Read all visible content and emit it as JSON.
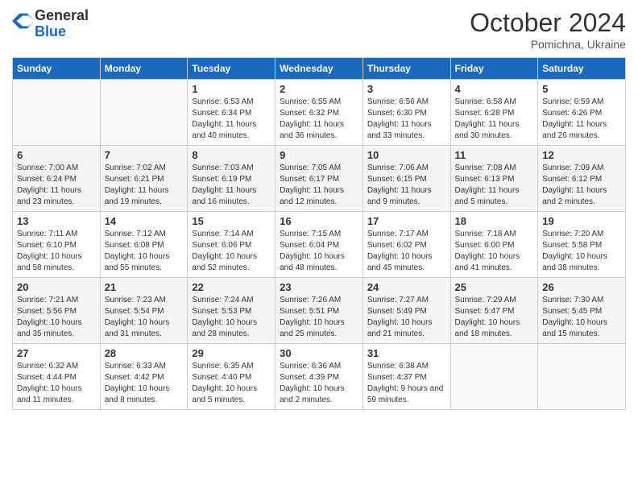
{
  "header": {
    "logo_general": "General",
    "logo_blue": "Blue",
    "month_title": "October 2024",
    "subtitle": "Pomichna, Ukraine"
  },
  "days_of_week": [
    "Sunday",
    "Monday",
    "Tuesday",
    "Wednesday",
    "Thursday",
    "Friday",
    "Saturday"
  ],
  "weeks": [
    [
      {
        "day": "",
        "info": ""
      },
      {
        "day": "",
        "info": ""
      },
      {
        "day": "1",
        "info": "Sunrise: 6:53 AM\nSunset: 6:34 PM\nDaylight: 11 hours and 40 minutes."
      },
      {
        "day": "2",
        "info": "Sunrise: 6:55 AM\nSunset: 6:32 PM\nDaylight: 11 hours and 36 minutes."
      },
      {
        "day": "3",
        "info": "Sunrise: 6:56 AM\nSunset: 6:30 PM\nDaylight: 11 hours and 33 minutes."
      },
      {
        "day": "4",
        "info": "Sunrise: 6:58 AM\nSunset: 6:28 PM\nDaylight: 11 hours and 30 minutes."
      },
      {
        "day": "5",
        "info": "Sunrise: 6:59 AM\nSunset: 6:26 PM\nDaylight: 11 hours and 26 minutes."
      }
    ],
    [
      {
        "day": "6",
        "info": "Sunrise: 7:00 AM\nSunset: 6:24 PM\nDaylight: 11 hours and 23 minutes."
      },
      {
        "day": "7",
        "info": "Sunrise: 7:02 AM\nSunset: 6:21 PM\nDaylight: 11 hours and 19 minutes."
      },
      {
        "day": "8",
        "info": "Sunrise: 7:03 AM\nSunset: 6:19 PM\nDaylight: 11 hours and 16 minutes."
      },
      {
        "day": "9",
        "info": "Sunrise: 7:05 AM\nSunset: 6:17 PM\nDaylight: 11 hours and 12 minutes."
      },
      {
        "day": "10",
        "info": "Sunrise: 7:06 AM\nSunset: 6:15 PM\nDaylight: 11 hours and 9 minutes."
      },
      {
        "day": "11",
        "info": "Sunrise: 7:08 AM\nSunset: 6:13 PM\nDaylight: 11 hours and 5 minutes."
      },
      {
        "day": "12",
        "info": "Sunrise: 7:09 AM\nSunset: 6:12 PM\nDaylight: 11 hours and 2 minutes."
      }
    ],
    [
      {
        "day": "13",
        "info": "Sunrise: 7:11 AM\nSunset: 6:10 PM\nDaylight: 10 hours and 58 minutes."
      },
      {
        "day": "14",
        "info": "Sunrise: 7:12 AM\nSunset: 6:08 PM\nDaylight: 10 hours and 55 minutes."
      },
      {
        "day": "15",
        "info": "Sunrise: 7:14 AM\nSunset: 6:06 PM\nDaylight: 10 hours and 52 minutes."
      },
      {
        "day": "16",
        "info": "Sunrise: 7:15 AM\nSunset: 6:04 PM\nDaylight: 10 hours and 48 minutes."
      },
      {
        "day": "17",
        "info": "Sunrise: 7:17 AM\nSunset: 6:02 PM\nDaylight: 10 hours and 45 minutes."
      },
      {
        "day": "18",
        "info": "Sunrise: 7:18 AM\nSunset: 6:00 PM\nDaylight: 10 hours and 41 minutes."
      },
      {
        "day": "19",
        "info": "Sunrise: 7:20 AM\nSunset: 5:58 PM\nDaylight: 10 hours and 38 minutes."
      }
    ],
    [
      {
        "day": "20",
        "info": "Sunrise: 7:21 AM\nSunset: 5:56 PM\nDaylight: 10 hours and 35 minutes."
      },
      {
        "day": "21",
        "info": "Sunrise: 7:23 AM\nSunset: 5:54 PM\nDaylight: 10 hours and 31 minutes."
      },
      {
        "day": "22",
        "info": "Sunrise: 7:24 AM\nSunset: 5:53 PM\nDaylight: 10 hours and 28 minutes."
      },
      {
        "day": "23",
        "info": "Sunrise: 7:26 AM\nSunset: 5:51 PM\nDaylight: 10 hours and 25 minutes."
      },
      {
        "day": "24",
        "info": "Sunrise: 7:27 AM\nSunset: 5:49 PM\nDaylight: 10 hours and 21 minutes."
      },
      {
        "day": "25",
        "info": "Sunrise: 7:29 AM\nSunset: 5:47 PM\nDaylight: 10 hours and 18 minutes."
      },
      {
        "day": "26",
        "info": "Sunrise: 7:30 AM\nSunset: 5:45 PM\nDaylight: 10 hours and 15 minutes."
      }
    ],
    [
      {
        "day": "27",
        "info": "Sunrise: 6:32 AM\nSunset: 4:44 PM\nDaylight: 10 hours and 11 minutes."
      },
      {
        "day": "28",
        "info": "Sunrise: 6:33 AM\nSunset: 4:42 PM\nDaylight: 10 hours and 8 minutes."
      },
      {
        "day": "29",
        "info": "Sunrise: 6:35 AM\nSunset: 4:40 PM\nDaylight: 10 hours and 5 minutes."
      },
      {
        "day": "30",
        "info": "Sunrise: 6:36 AM\nSunset: 4:39 PM\nDaylight: 10 hours and 2 minutes."
      },
      {
        "day": "31",
        "info": "Sunrise: 6:38 AM\nSunset: 4:37 PM\nDaylight: 9 hours and 59 minutes."
      },
      {
        "day": "",
        "info": ""
      },
      {
        "day": "",
        "info": ""
      }
    ]
  ]
}
